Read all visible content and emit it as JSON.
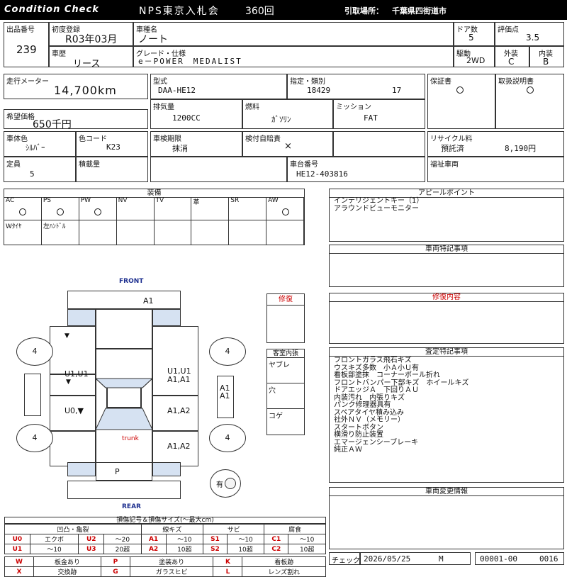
{
  "header": {
    "title_left": "Condition Check",
    "auction": "NPS東京入札会",
    "round": "360回",
    "pickup_label": "引取場所：",
    "pickup_place": "千葉県四街道市"
  },
  "row1": {
    "lot_label": "出品番号",
    "lot": "239",
    "first_reg_label": "初度登録",
    "first_reg": "R03年03月",
    "car_name_label": "車種名",
    "car_name": "ノート",
    "doors_label": "ドア数",
    "doors": "5",
    "score_label": "評価点",
    "score": "3.5",
    "history_label": "車歴",
    "history": "リース",
    "grade_label": "グレード・仕様",
    "grade": "e－POWER　MEDALIST",
    "drive_label": "駆動",
    "drive": "2WD",
    "exterior_label": "外装",
    "exterior": "C",
    "interior_label": "内装",
    "interior": "B"
  },
  "row2": {
    "mileage_label": "走行メーター",
    "mileage": "14,700km",
    "model_label": "型式",
    "model": "DAA-HE12",
    "class_label": "指定・類別",
    "class_a": "18429",
    "class_b": "17",
    "warranty_label": "保証書",
    "manual_label": "取扱説明書",
    "price_label": "希望価格",
    "price": "650千円",
    "displacement_label": "排気量",
    "displacement": "1200CC",
    "fuel_label": "燃料",
    "fuel": "ｶﾞｿﾘﾝ",
    "mission_label": "ミッション",
    "mission": "FAT",
    "color_label": "車体色",
    "color": "ｼﾙﾊﾞｰ",
    "color_code_label": "色コード",
    "color_code": "K23",
    "inspection_label": "車検期限",
    "inspection": "抹消",
    "insurance_label": "検付自賠責",
    "insurance": "×",
    "recycle_label": "リサイクル料",
    "recycle_status": "預託済",
    "recycle_fee": "8,190円",
    "capacity_label": "定員",
    "capacity": "5",
    "load_label": "積載量",
    "chassis_label": "車台番号",
    "chassis": "HE12-403816",
    "welfare_label": "福祉車両"
  },
  "equipment": {
    "title": "装備",
    "top": [
      {
        "label": "AC",
        "on": true
      },
      {
        "label": "PS",
        "on": true
      },
      {
        "label": "PW",
        "on": true
      },
      {
        "label": "NV",
        "on": false
      },
      {
        "label": "TV",
        "on": false
      },
      {
        "label": "革",
        "on": false
      },
      {
        "label": "SR",
        "on": false
      },
      {
        "label": "AW",
        "on": true
      }
    ],
    "bottom": [
      "Wﾀｲﾔ",
      "左ﾊﾝﾄﾞﾙ",
      "",
      "",
      "",
      "",
      "",
      ""
    ]
  },
  "appeal": {
    "title": "アピールポイント",
    "lines": [
      "インテリジェントキー（1）",
      "アラウンドビューモニター"
    ]
  },
  "vehicle_notes": {
    "title": "車両特記事項"
  },
  "repair_box": {
    "title": "修復"
  },
  "repair_content": {
    "title": "修復内容"
  },
  "cabin": {
    "title": "客室内張",
    "items": [
      "ヤブレ",
      "穴",
      "コゲ"
    ]
  },
  "inspection_notes": {
    "title": "査定特記事項",
    "lines": [
      "フロントガラス飛石キズ",
      "ウスキズ多数　小Ａ小Ｕ有",
      "看板部塗抹　コーナーポール折れ",
      "フロントバンパー下部キズ　ホイールキズ",
      "ドアエッジＡ　下回りＡＵ",
      "内装汚れ　内張りキズ",
      "パンク修理器具有",
      "スペアタイヤ積み込み",
      "社外ＮＶ（メモリー）",
      "スタートボタン",
      "横滑り防止装置",
      "エマージェンシーブレーキ",
      "純正ＡＷ"
    ]
  },
  "change_info": {
    "title": "車両変更情報"
  },
  "diagram": {
    "front": "FRONT",
    "rear": "REAR",
    "trunk": "trunk",
    "tires": [
      "4",
      "4",
      "4",
      "4"
    ],
    "front_panel": "A1",
    "left_front_mark": "▼",
    "left_door_front": "U1,U1",
    "left_door_front_mark": "▼",
    "left_door_rear": "U0,▼",
    "right_front_1": "U1,U1",
    "right_front_2": "A1,A1",
    "right_side_1": "A1",
    "right_side_2": "A1",
    "right_door_rear": "A1,A2",
    "right_rear": "A1,A2",
    "rear_panel": "P",
    "spare": "有"
  },
  "legend": {
    "title": "損傷記号＆損傷サイズ(～最大cm)",
    "groups": [
      "凹凸・亀裂",
      "線キズ",
      "サビ",
      "腐食"
    ],
    "rows": [
      [
        [
          "U0",
          "エクボ"
        ],
        [
          "U2",
          "～20"
        ],
        [
          "A1",
          "～10"
        ],
        [
          "S1",
          "～10"
        ],
        [
          "C1",
          "～10"
        ]
      ],
      [
        [
          "U1",
          "～10"
        ],
        [
          "U3",
          "20超"
        ],
        [
          "A2",
          "10超"
        ],
        [
          "S2",
          "10超"
        ],
        [
          "C2",
          "10超"
        ]
      ]
    ],
    "rows2": [
      [
        [
          "W",
          "板金あり"
        ],
        [
          "P",
          "塗装あり"
        ],
        [
          "K",
          "看板跡"
        ]
      ],
      [
        [
          "X",
          "交換跡"
        ],
        [
          "G",
          "ガラスヒビ"
        ],
        [
          "L",
          "レンズ割れ"
        ]
      ]
    ]
  },
  "footer": {
    "check_label": "チェック",
    "date": "2026/05/25",
    "checker": "M",
    "code1": "00001-00",
    "code2": "0016"
  }
}
